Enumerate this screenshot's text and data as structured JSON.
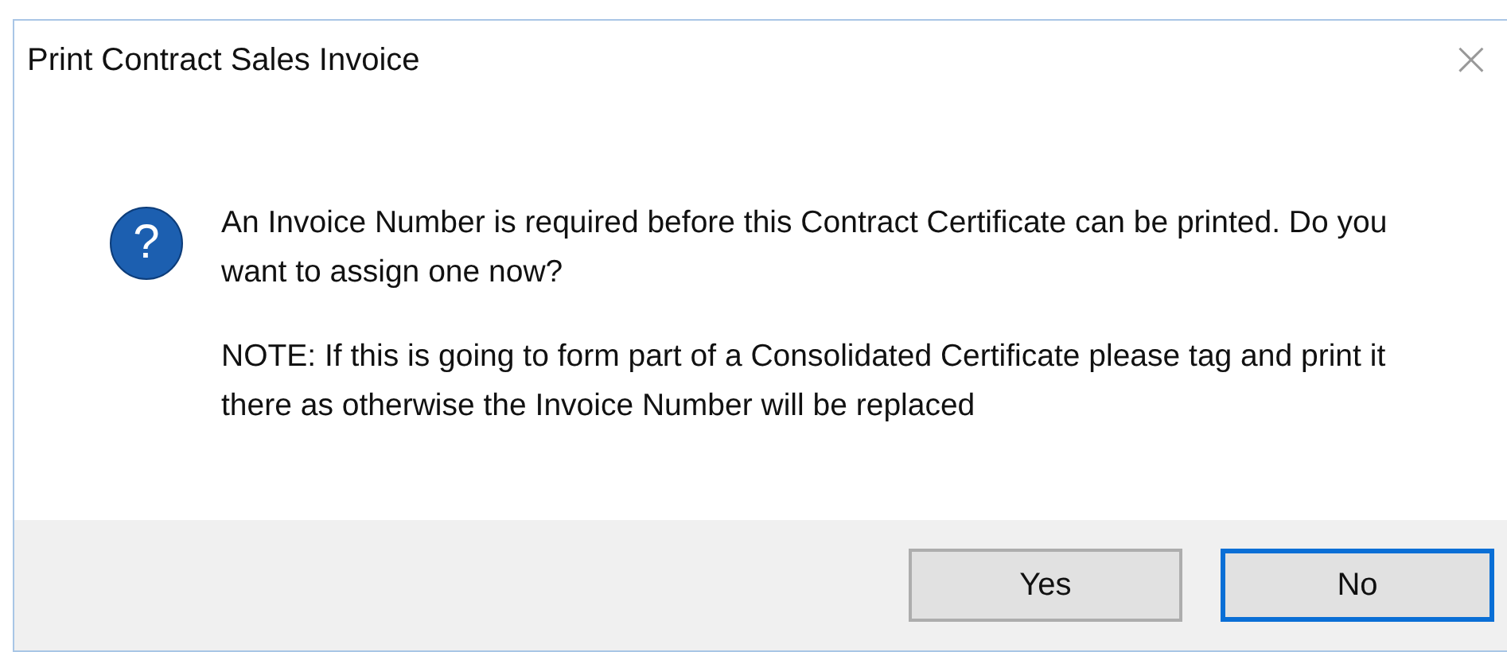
{
  "window": {
    "title": "Print Contract Sales Invoice",
    "close": "×"
  },
  "message": {
    "icon": "?",
    "paragraphs": [
      "An Invoice Number is required before this Contract Certificate can be printed. Do you want to assign one now?",
      "NOTE: If this is going to form part of a Consolidated Certificate please tag and print it there as otherwise the Invoice Number will be replaced"
    ]
  },
  "buttons": [
    {
      "label": "Yes",
      "focused": false
    },
    {
      "label": "No",
      "focused": true
    }
  ]
}
